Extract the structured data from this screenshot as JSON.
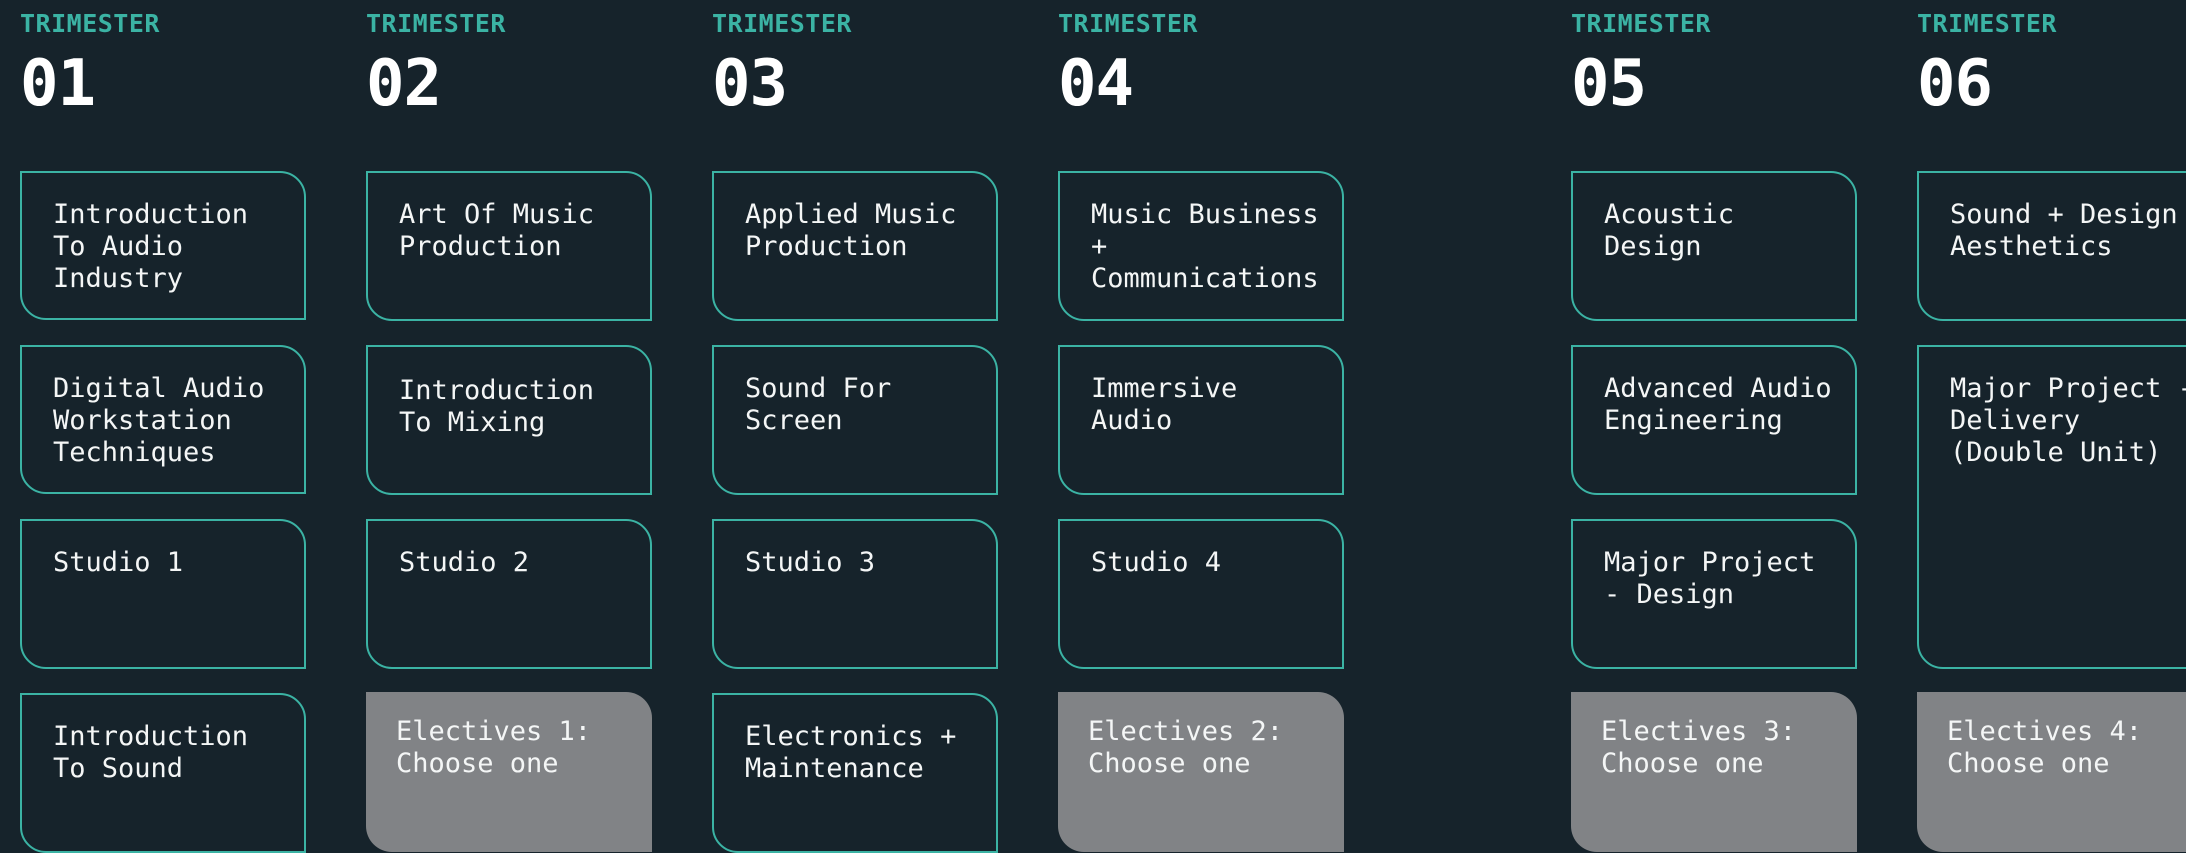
{
  "trimester_label": "TRIMESTER",
  "trimesters": [
    {
      "number": "01",
      "units": [
        "Introduction To Audio Industry",
        "Digital Audio Workstation Techniques",
        "Studio 1",
        "Introduction To Sound"
      ]
    },
    {
      "number": "02",
      "units": [
        "Art Of Music Production",
        "Introduction To Mixing",
        "Studio 2"
      ],
      "elective": "Electives 1: Choose one"
    },
    {
      "number": "03",
      "units": [
        "Applied Music Production",
        "Sound For Screen",
        "Studio 3",
        "Electronics + Maintenance"
      ]
    },
    {
      "number": "04",
      "units": [
        "Music Business + Communications",
        "Immersive Audio",
        "Studio 4"
      ],
      "elective": "Electives 2: Choose one"
    },
    {
      "number": "05",
      "units": [
        "Acoustic Design",
        "Advanced Audio Engineering",
        "Major Project - Design"
      ],
      "elective": "Electives 3: Choose one"
    },
    {
      "number": "06",
      "units": [
        "Sound + Design Aesthetics",
        "Major Project - Delivery (Double Unit)"
      ],
      "elective": "Electives 4: Choose one"
    }
  ],
  "colors": {
    "background": "#16232b",
    "accent": "#3bb3a4",
    "elective_fill": "#818386"
  }
}
